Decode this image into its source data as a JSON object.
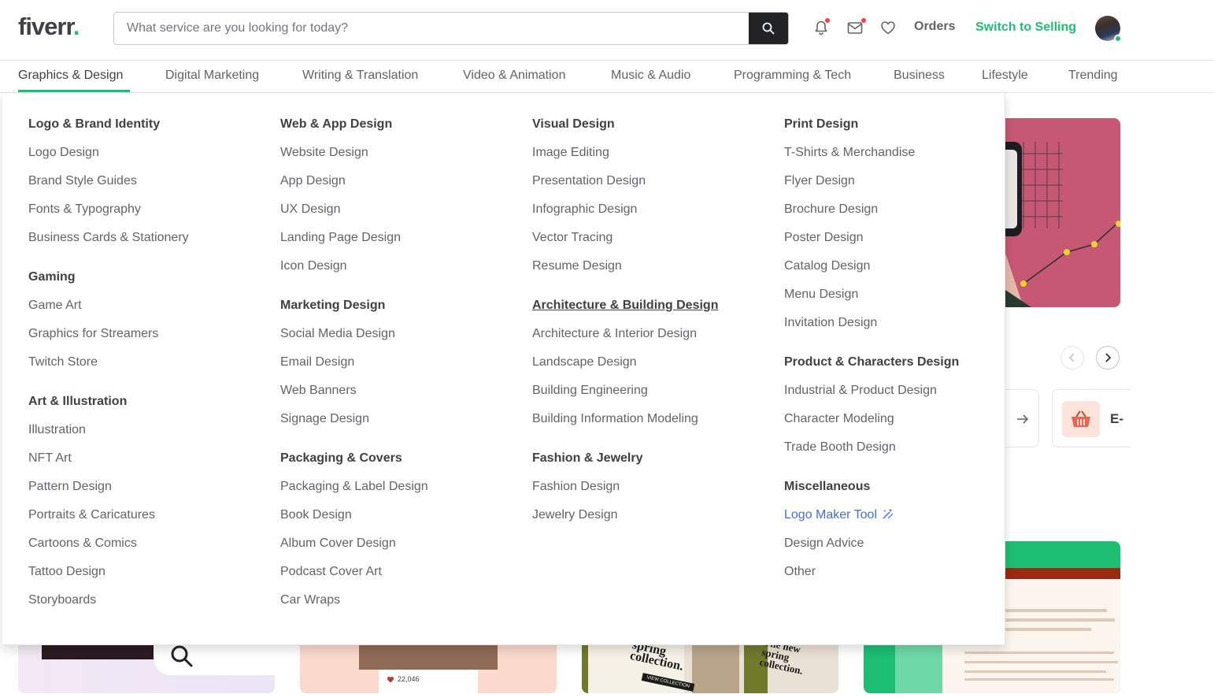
{
  "header": {
    "logo_text": "fiverr",
    "logo_dot": ".",
    "search_placeholder": "What service are you looking for today?",
    "orders_label": "Orders",
    "switch_label": "Switch to Selling"
  },
  "categories": [
    {
      "label": "Graphics & Design"
    },
    {
      "label": "Digital Marketing"
    },
    {
      "label": "Writing & Translation"
    },
    {
      "label": "Video & Animation"
    },
    {
      "label": "Music & Audio"
    },
    {
      "label": "Programming & Tech"
    },
    {
      "label": "Business"
    },
    {
      "label": "Lifestyle"
    },
    {
      "label": "Trending"
    }
  ],
  "menu": {
    "columns": [
      {
        "groups": [
          {
            "heading": "Logo & Brand Identity",
            "items": [
              "Logo Design",
              "Brand Style Guides",
              "Fonts & Typography",
              "Business Cards & Stationery"
            ]
          },
          {
            "heading": "Gaming",
            "items": [
              "Game Art",
              "Graphics for Streamers",
              "Twitch Store"
            ]
          },
          {
            "heading": "Art & Illustration",
            "items": [
              "Illustration",
              "NFT Art",
              "Pattern Design",
              "Portraits & Caricatures",
              "Cartoons & Comics",
              "Tattoo Design",
              "Storyboards"
            ]
          }
        ]
      },
      {
        "groups": [
          {
            "heading": "Web & App Design",
            "items": [
              "Website Design",
              "App Design",
              "UX Design",
              "Landing Page Design",
              "Icon Design"
            ]
          },
          {
            "heading": "Marketing Design",
            "items": [
              "Social Media Design",
              "Email Design",
              "Web Banners",
              "Signage Design"
            ]
          },
          {
            "heading": "Packaging & Covers",
            "items": [
              "Packaging & Label Design",
              "Book Design",
              "Album Cover Design",
              "Podcast Cover Art",
              "Car Wraps"
            ]
          }
        ]
      },
      {
        "groups": [
          {
            "heading": "Visual Design",
            "items": [
              "Image Editing",
              "Presentation Design",
              "Infographic Design",
              "Vector Tracing",
              "Resume Design"
            ]
          },
          {
            "heading": "Architecture & Building Design",
            "items": [
              "Architecture & Interior Design",
              "Landscape Design",
              "Building Engineering",
              "Building Information Modeling"
            ]
          },
          {
            "heading": "Fashion & Jewelry",
            "items": [
              "Fashion Design",
              "Jewelry Design"
            ]
          }
        ]
      },
      {
        "groups": [
          {
            "heading": "Print Design",
            "items": [
              "T-Shirts & Merchandise",
              "Flyer Design",
              "Brochure Design",
              "Poster Design",
              "Catalog Design",
              "Menu Design",
              "Invitation Design"
            ]
          },
          {
            "heading": "Product & Characters Design",
            "items": [
              "Industrial & Product Design",
              "Character Modeling",
              "Trade Booth Design"
            ]
          },
          {
            "heading": "Miscellaneous",
            "items": [
              "Logo Maker Tool",
              "Design Advice",
              "Other"
            ]
          }
        ]
      }
    ]
  },
  "background": {
    "card_label": "E-",
    "likes_count": "22,046",
    "collection_text": "spring collection.",
    "collection_text_2": "The new spring collection.",
    "view_collection": "VIEW COLLECTION"
  },
  "colors": {
    "brand_green": "#1dbf73",
    "text_dark": "#404145",
    "text_muted": "#62646a",
    "link_blue": "#446ee7",
    "notification_red": "#f74040",
    "hero_pink": "#c65874"
  }
}
